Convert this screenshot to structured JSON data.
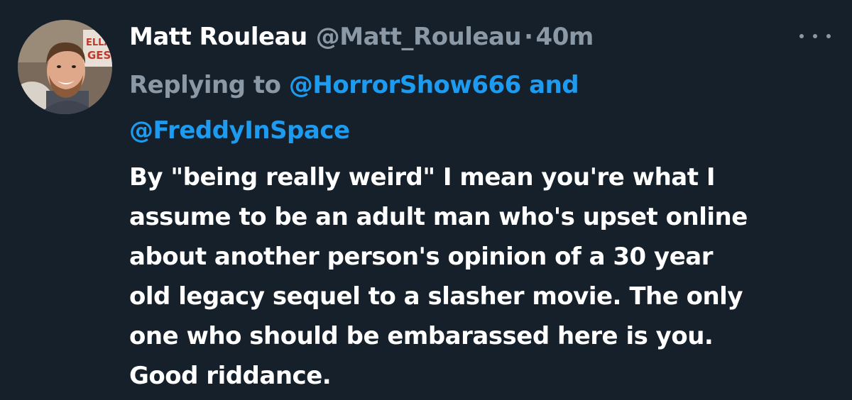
{
  "tweet": {
    "author": {
      "display_name": "Matt Rouleau",
      "handle": "@Matt_Rouleau",
      "separator": "·",
      "timestamp": "40m"
    },
    "more_icon": "more-horizontal-icon",
    "reply": {
      "prefix": "Replying to",
      "mention_1": "@HorrorShow666",
      "conjunction": "and",
      "mention_2": "@FreddyInSpace"
    },
    "body_lines": [
      "By \"being really weird\" I mean you're what I",
      "assume to be an adult man who's upset online",
      "about another person's opinion of a 30 year",
      "old legacy sequel to a slasher movie. The only",
      "one who should be embarassed here is you.",
      "Good riddance."
    ],
    "avatar_sign_text": [
      "ELLA",
      "GES"
    ]
  },
  "colors": {
    "background": "#15202b",
    "primary_text": "#ffffff",
    "secondary_text": "#8b98a5",
    "accent": "#1d9bf0"
  }
}
